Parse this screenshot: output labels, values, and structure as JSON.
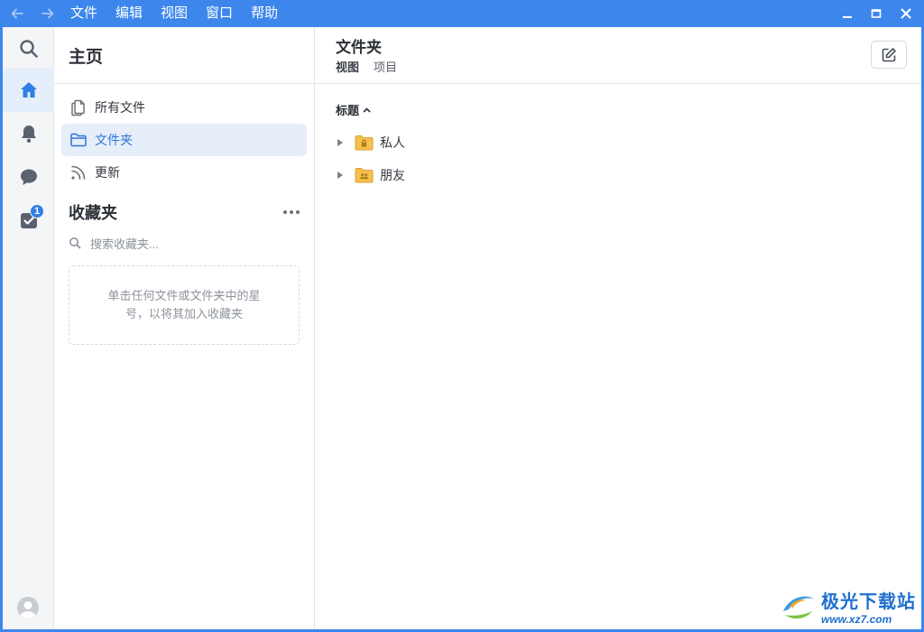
{
  "menu": [
    "文件",
    "编辑",
    "视图",
    "窗口",
    "帮助"
  ],
  "sidebar": {
    "title": "主页",
    "items": [
      {
        "label": "所有文件",
        "icon": "files-icon"
      },
      {
        "label": "文件夹",
        "icon": "folder-icon"
      },
      {
        "label": "更新",
        "icon": "rss-icon"
      }
    ],
    "favorites": {
      "title": "收藏夹",
      "search_placeholder": "搜索收藏夹...",
      "empty_message": "单击任何文件或文件夹中的星号，以将其加入收藏夹"
    }
  },
  "rail": {
    "tasks_badge": "1"
  },
  "main": {
    "title": "文件夹",
    "tabs": [
      "视图",
      "项目"
    ],
    "sort_label": "标题",
    "folders": [
      {
        "name": "私人",
        "icon": "locked-folder-icon"
      },
      {
        "name": "朋友",
        "icon": "shared-folder-icon"
      }
    ]
  },
  "watermark": {
    "name": "极光下载站",
    "url": "www.xz7.com"
  },
  "colors": {
    "accent": "#3d86ec",
    "active_bg": "#e6eefa",
    "folder": "#f5c14e"
  }
}
